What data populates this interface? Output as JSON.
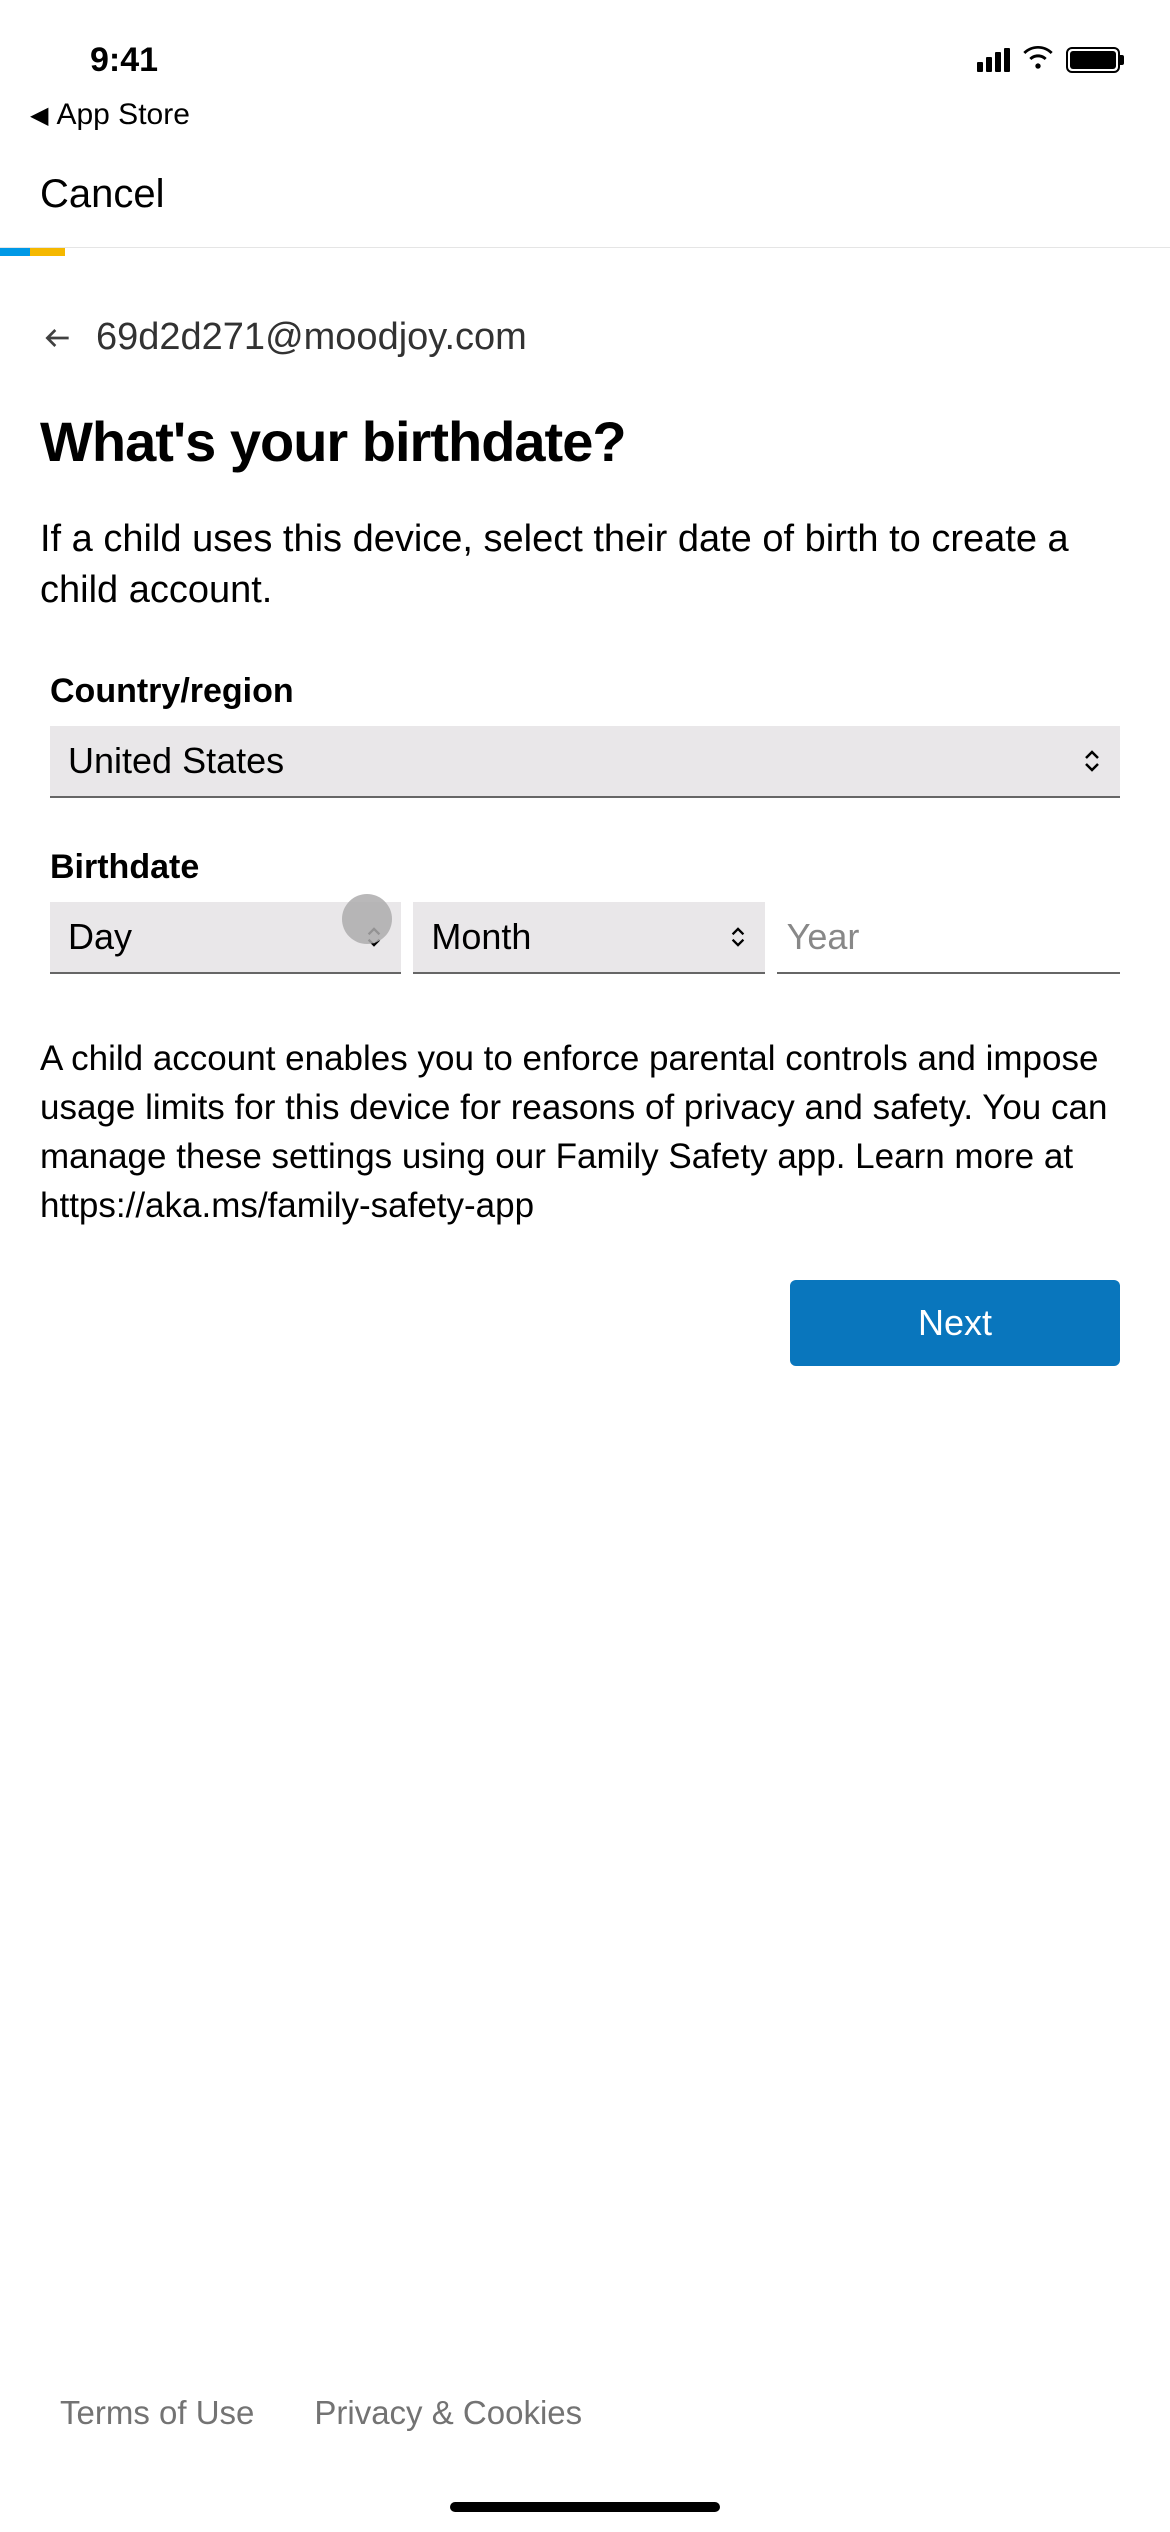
{
  "status_bar": {
    "time": "9:41"
  },
  "nav": {
    "back_label": "App Store",
    "cancel_label": "Cancel"
  },
  "account": {
    "email": "69d2d271@moodjoy.com"
  },
  "page": {
    "title": "What's your birthdate?",
    "subtitle": "If a child uses this device, select their date of birth to create a child account."
  },
  "form": {
    "country_label": "Country/region",
    "country_value": "United States",
    "birthdate_label": "Birthdate",
    "day_placeholder": "Day",
    "month_placeholder": "Month",
    "year_placeholder": "Year"
  },
  "help_text": "A child account enables you to enforce parental controls and impose usage limits for this device for reasons of privacy and safety. You can manage these settings using our Family Safety app. Learn more at https://aka.ms/family-safety-app",
  "actions": {
    "next_label": "Next"
  },
  "footer": {
    "terms": "Terms of Use",
    "privacy": "Privacy & Cookies"
  }
}
